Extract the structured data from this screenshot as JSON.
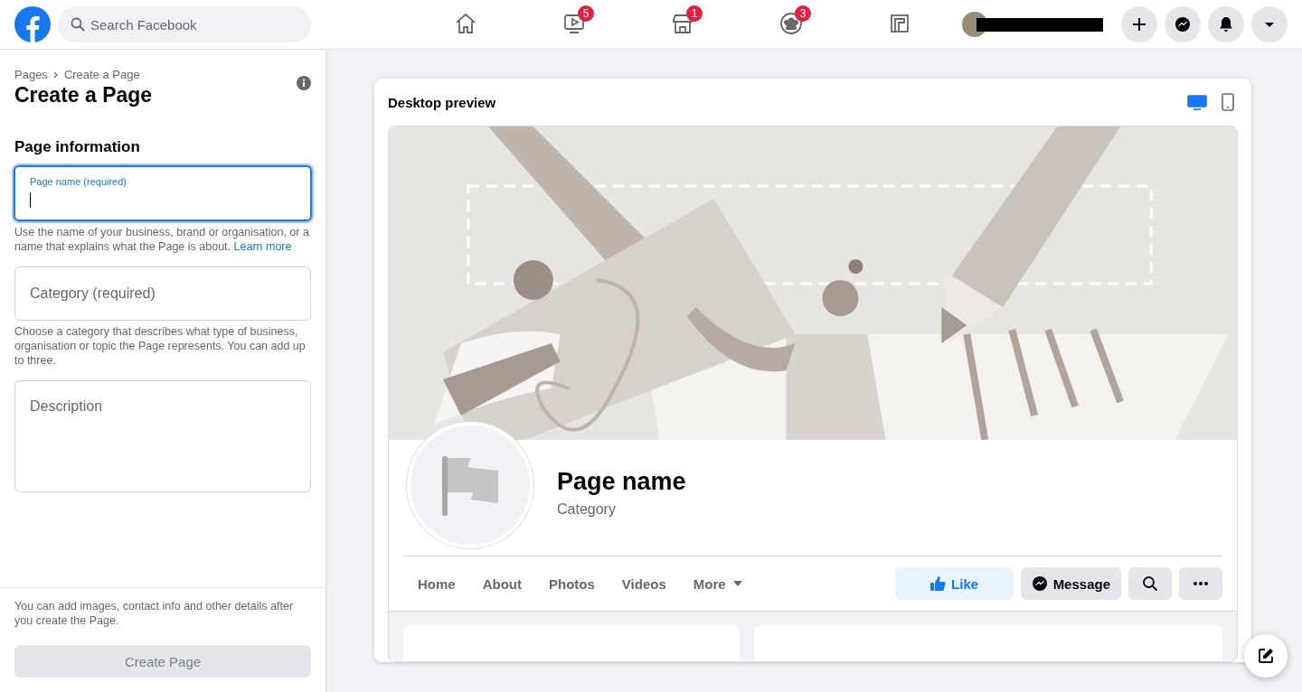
{
  "topbar": {
    "search": {
      "placeholder": "Search Facebook"
    },
    "nav": [
      {
        "kind": "home",
        "selected": false
      },
      {
        "kind": "watch",
        "badge": "5",
        "selected": false
      },
      {
        "kind": "marketplace",
        "badge": "1",
        "selected": false
      },
      {
        "kind": "groups",
        "badge": "3",
        "selected": false
      },
      {
        "kind": "gaming",
        "selected": false
      }
    ],
    "actions": [
      {
        "kind": "create"
      },
      {
        "kind": "messenger"
      },
      {
        "kind": "notifications"
      },
      {
        "kind": "account"
      }
    ]
  },
  "sidebar": {
    "breadcrumb": [
      "Pages",
      "Create a Page"
    ],
    "title": "Create a Page",
    "section": "Page information",
    "fields": [
      {
        "kind": "input",
        "label": "Page name (required)",
        "focused": true,
        "help": "Use the name of your business, brand or organisation, or a name that explains what the Page is about.",
        "link": "Learn more"
      },
      {
        "kind": "input",
        "label": "Category (required)",
        "focused": false,
        "help": "Choose a category that describes what type of business, organisation or topic the Page represents. You can add up to three."
      },
      {
        "kind": "textarea",
        "label": "Description",
        "focused": false
      }
    ],
    "footer_note": "You can add images, contact info and other details after you create the Page.",
    "submit": {
      "label": "Create Page",
      "disabled": true
    }
  },
  "preview": {
    "title": "Desktop preview",
    "views": [
      {
        "kind": "desktop",
        "selected": true
      },
      {
        "kind": "mobile",
        "selected": false
      }
    ],
    "page_name": "Page name",
    "category": "Category",
    "tabs": [
      {
        "label": "Home",
        "dropdown": false
      },
      {
        "label": "About",
        "dropdown": false
      },
      {
        "label": "Photos",
        "dropdown": false
      },
      {
        "label": "Videos",
        "dropdown": false
      },
      {
        "label": "More",
        "dropdown": true
      }
    ],
    "buttons": [
      {
        "kind": "like",
        "label": "Like"
      },
      {
        "kind": "message",
        "label": "Message"
      },
      {
        "kind": "search"
      },
      {
        "kind": "more"
      }
    ]
  }
}
